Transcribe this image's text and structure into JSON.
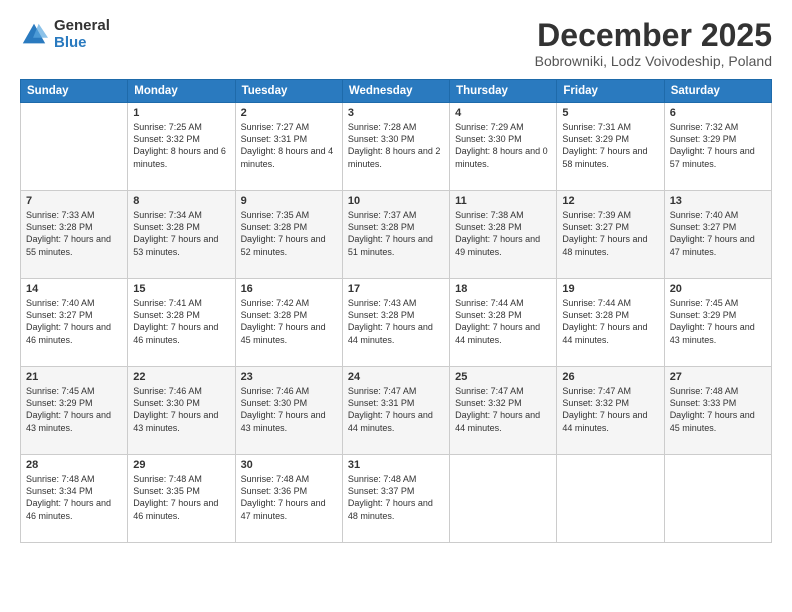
{
  "header": {
    "logo_general": "General",
    "logo_blue": "Blue",
    "month_title": "December 2025",
    "location": "Bobrowniki, Lodz Voivodeship, Poland"
  },
  "weekdays": [
    "Sunday",
    "Monday",
    "Tuesday",
    "Wednesday",
    "Thursday",
    "Friday",
    "Saturday"
  ],
  "weeks": [
    [
      {
        "day": "",
        "sunrise": "",
        "sunset": "",
        "daylight": ""
      },
      {
        "day": "1",
        "sunrise": "Sunrise: 7:25 AM",
        "sunset": "Sunset: 3:32 PM",
        "daylight": "Daylight: 8 hours and 6 minutes."
      },
      {
        "day": "2",
        "sunrise": "Sunrise: 7:27 AM",
        "sunset": "Sunset: 3:31 PM",
        "daylight": "Daylight: 8 hours and 4 minutes."
      },
      {
        "day": "3",
        "sunrise": "Sunrise: 7:28 AM",
        "sunset": "Sunset: 3:30 PM",
        "daylight": "Daylight: 8 hours and 2 minutes."
      },
      {
        "day": "4",
        "sunrise": "Sunrise: 7:29 AM",
        "sunset": "Sunset: 3:30 PM",
        "daylight": "Daylight: 8 hours and 0 minutes."
      },
      {
        "day": "5",
        "sunrise": "Sunrise: 7:31 AM",
        "sunset": "Sunset: 3:29 PM",
        "daylight": "Daylight: 7 hours and 58 minutes."
      },
      {
        "day": "6",
        "sunrise": "Sunrise: 7:32 AM",
        "sunset": "Sunset: 3:29 PM",
        "daylight": "Daylight: 7 hours and 57 minutes."
      }
    ],
    [
      {
        "day": "7",
        "sunrise": "Sunrise: 7:33 AM",
        "sunset": "Sunset: 3:28 PM",
        "daylight": "Daylight: 7 hours and 55 minutes."
      },
      {
        "day": "8",
        "sunrise": "Sunrise: 7:34 AM",
        "sunset": "Sunset: 3:28 PM",
        "daylight": "Daylight: 7 hours and 53 minutes."
      },
      {
        "day": "9",
        "sunrise": "Sunrise: 7:35 AM",
        "sunset": "Sunset: 3:28 PM",
        "daylight": "Daylight: 7 hours and 52 minutes."
      },
      {
        "day": "10",
        "sunrise": "Sunrise: 7:37 AM",
        "sunset": "Sunset: 3:28 PM",
        "daylight": "Daylight: 7 hours and 51 minutes."
      },
      {
        "day": "11",
        "sunrise": "Sunrise: 7:38 AM",
        "sunset": "Sunset: 3:28 PM",
        "daylight": "Daylight: 7 hours and 49 minutes."
      },
      {
        "day": "12",
        "sunrise": "Sunrise: 7:39 AM",
        "sunset": "Sunset: 3:27 PM",
        "daylight": "Daylight: 7 hours and 48 minutes."
      },
      {
        "day": "13",
        "sunrise": "Sunrise: 7:40 AM",
        "sunset": "Sunset: 3:27 PM",
        "daylight": "Daylight: 7 hours and 47 minutes."
      }
    ],
    [
      {
        "day": "14",
        "sunrise": "Sunrise: 7:40 AM",
        "sunset": "Sunset: 3:27 PM",
        "daylight": "Daylight: 7 hours and 46 minutes."
      },
      {
        "day": "15",
        "sunrise": "Sunrise: 7:41 AM",
        "sunset": "Sunset: 3:28 PM",
        "daylight": "Daylight: 7 hours and 46 minutes."
      },
      {
        "day": "16",
        "sunrise": "Sunrise: 7:42 AM",
        "sunset": "Sunset: 3:28 PM",
        "daylight": "Daylight: 7 hours and 45 minutes."
      },
      {
        "day": "17",
        "sunrise": "Sunrise: 7:43 AM",
        "sunset": "Sunset: 3:28 PM",
        "daylight": "Daylight: 7 hours and 44 minutes."
      },
      {
        "day": "18",
        "sunrise": "Sunrise: 7:44 AM",
        "sunset": "Sunset: 3:28 PM",
        "daylight": "Daylight: 7 hours and 44 minutes."
      },
      {
        "day": "19",
        "sunrise": "Sunrise: 7:44 AM",
        "sunset": "Sunset: 3:28 PM",
        "daylight": "Daylight: 7 hours and 44 minutes."
      },
      {
        "day": "20",
        "sunrise": "Sunrise: 7:45 AM",
        "sunset": "Sunset: 3:29 PM",
        "daylight": "Daylight: 7 hours and 43 minutes."
      }
    ],
    [
      {
        "day": "21",
        "sunrise": "Sunrise: 7:45 AM",
        "sunset": "Sunset: 3:29 PM",
        "daylight": "Daylight: 7 hours and 43 minutes."
      },
      {
        "day": "22",
        "sunrise": "Sunrise: 7:46 AM",
        "sunset": "Sunset: 3:30 PM",
        "daylight": "Daylight: 7 hours and 43 minutes."
      },
      {
        "day": "23",
        "sunrise": "Sunrise: 7:46 AM",
        "sunset": "Sunset: 3:30 PM",
        "daylight": "Daylight: 7 hours and 43 minutes."
      },
      {
        "day": "24",
        "sunrise": "Sunrise: 7:47 AM",
        "sunset": "Sunset: 3:31 PM",
        "daylight": "Daylight: 7 hours and 44 minutes."
      },
      {
        "day": "25",
        "sunrise": "Sunrise: 7:47 AM",
        "sunset": "Sunset: 3:32 PM",
        "daylight": "Daylight: 7 hours and 44 minutes."
      },
      {
        "day": "26",
        "sunrise": "Sunrise: 7:47 AM",
        "sunset": "Sunset: 3:32 PM",
        "daylight": "Daylight: 7 hours and 44 minutes."
      },
      {
        "day": "27",
        "sunrise": "Sunrise: 7:48 AM",
        "sunset": "Sunset: 3:33 PM",
        "daylight": "Daylight: 7 hours and 45 minutes."
      }
    ],
    [
      {
        "day": "28",
        "sunrise": "Sunrise: 7:48 AM",
        "sunset": "Sunset: 3:34 PM",
        "daylight": "Daylight: 7 hours and 46 minutes."
      },
      {
        "day": "29",
        "sunrise": "Sunrise: 7:48 AM",
        "sunset": "Sunset: 3:35 PM",
        "daylight": "Daylight: 7 hours and 46 minutes."
      },
      {
        "day": "30",
        "sunrise": "Sunrise: 7:48 AM",
        "sunset": "Sunset: 3:36 PM",
        "daylight": "Daylight: 7 hours and 47 minutes."
      },
      {
        "day": "31",
        "sunrise": "Sunrise: 7:48 AM",
        "sunset": "Sunset: 3:37 PM",
        "daylight": "Daylight: 7 hours and 48 minutes."
      },
      {
        "day": "",
        "sunrise": "",
        "sunset": "",
        "daylight": ""
      },
      {
        "day": "",
        "sunrise": "",
        "sunset": "",
        "daylight": ""
      },
      {
        "day": "",
        "sunrise": "",
        "sunset": "",
        "daylight": ""
      }
    ]
  ]
}
